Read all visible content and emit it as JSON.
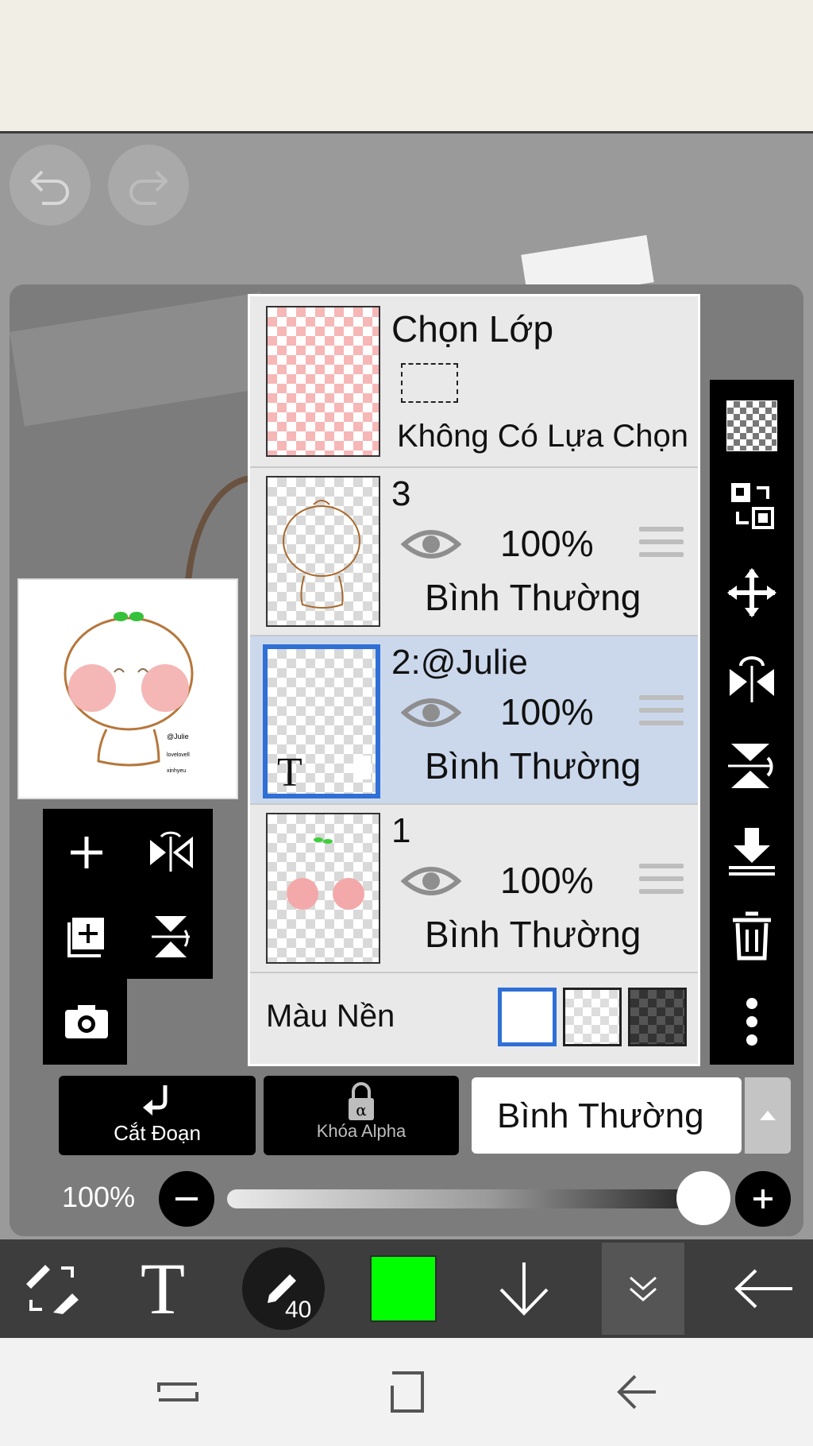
{
  "history": {
    "undo_icon": "undo-icon",
    "redo_icon": "redo-icon"
  },
  "layers": [
    {
      "id": "selection",
      "title": "Chọn Lớp",
      "subtitle": "Không Có Lựa Chọn"
    },
    {
      "id": "3",
      "name": "3",
      "opacity": "100%",
      "blend": "Bình Thường",
      "selected": false
    },
    {
      "id": "2",
      "name": "2:@Julie",
      "opacity": "100%",
      "blend": "Bình Thường",
      "selected": true,
      "thumb_text": "T"
    },
    {
      "id": "1",
      "name": "1",
      "opacity": "100%",
      "blend": "Bình Thường",
      "selected": false
    }
  ],
  "background": {
    "label": "Màu Nền",
    "options": [
      "white",
      "transparent",
      "dark"
    ],
    "selected": "white"
  },
  "actions": {
    "clip_label": "Cắt Đoạn",
    "alpha_lock_label": "Khóa Alpha",
    "blend_mode_value": "Bình Thường"
  },
  "opacity_slider": {
    "label": "100%",
    "value": 1.0
  },
  "toolbar": {
    "brush_size": "40",
    "color": "#00ff00"
  },
  "colors": {
    "accent": "#2f6fd6",
    "selected_row": "#cbd8ec",
    "current_color": "#00ff00"
  }
}
